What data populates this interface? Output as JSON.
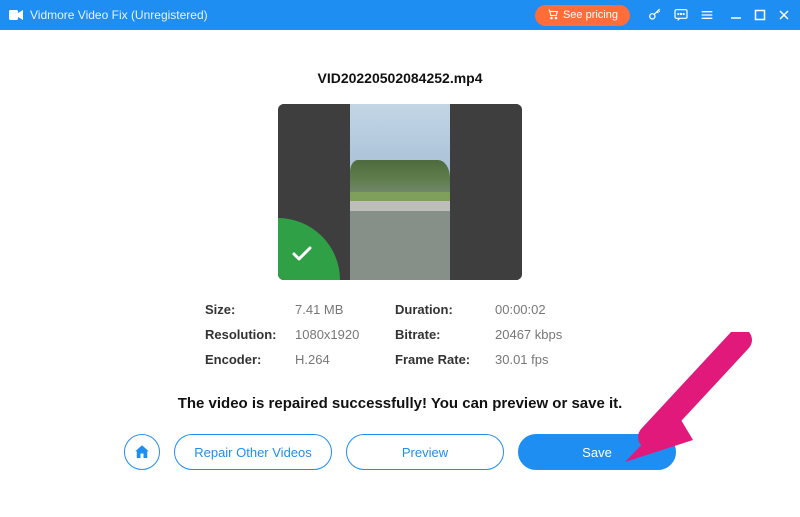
{
  "titlebar": {
    "title": "Vidmore Video Fix (Unregistered)",
    "pricing_label": "See pricing"
  },
  "file": {
    "name": "VID20220502084252.mp4"
  },
  "info": {
    "size_label": "Size:",
    "size": "7.41 MB",
    "duration_label": "Duration:",
    "duration": "00:00:02",
    "resolution_label": "Resolution:",
    "resolution": "1080x1920",
    "bitrate_label": "Bitrate:",
    "bitrate": "20467 kbps",
    "encoder_label": "Encoder:",
    "encoder": "H.264",
    "framerate_label": "Frame Rate:",
    "framerate": "30.01 fps"
  },
  "message": "The video is repaired successfully! You can preview or save it.",
  "buttons": {
    "repair_other": "Repair Other Videos",
    "preview": "Preview",
    "save": "Save"
  },
  "colors": {
    "accent": "#1f8ef3",
    "pricing": "#ff6d3a",
    "success": "#2fa046",
    "annotation": "#e0197a"
  }
}
